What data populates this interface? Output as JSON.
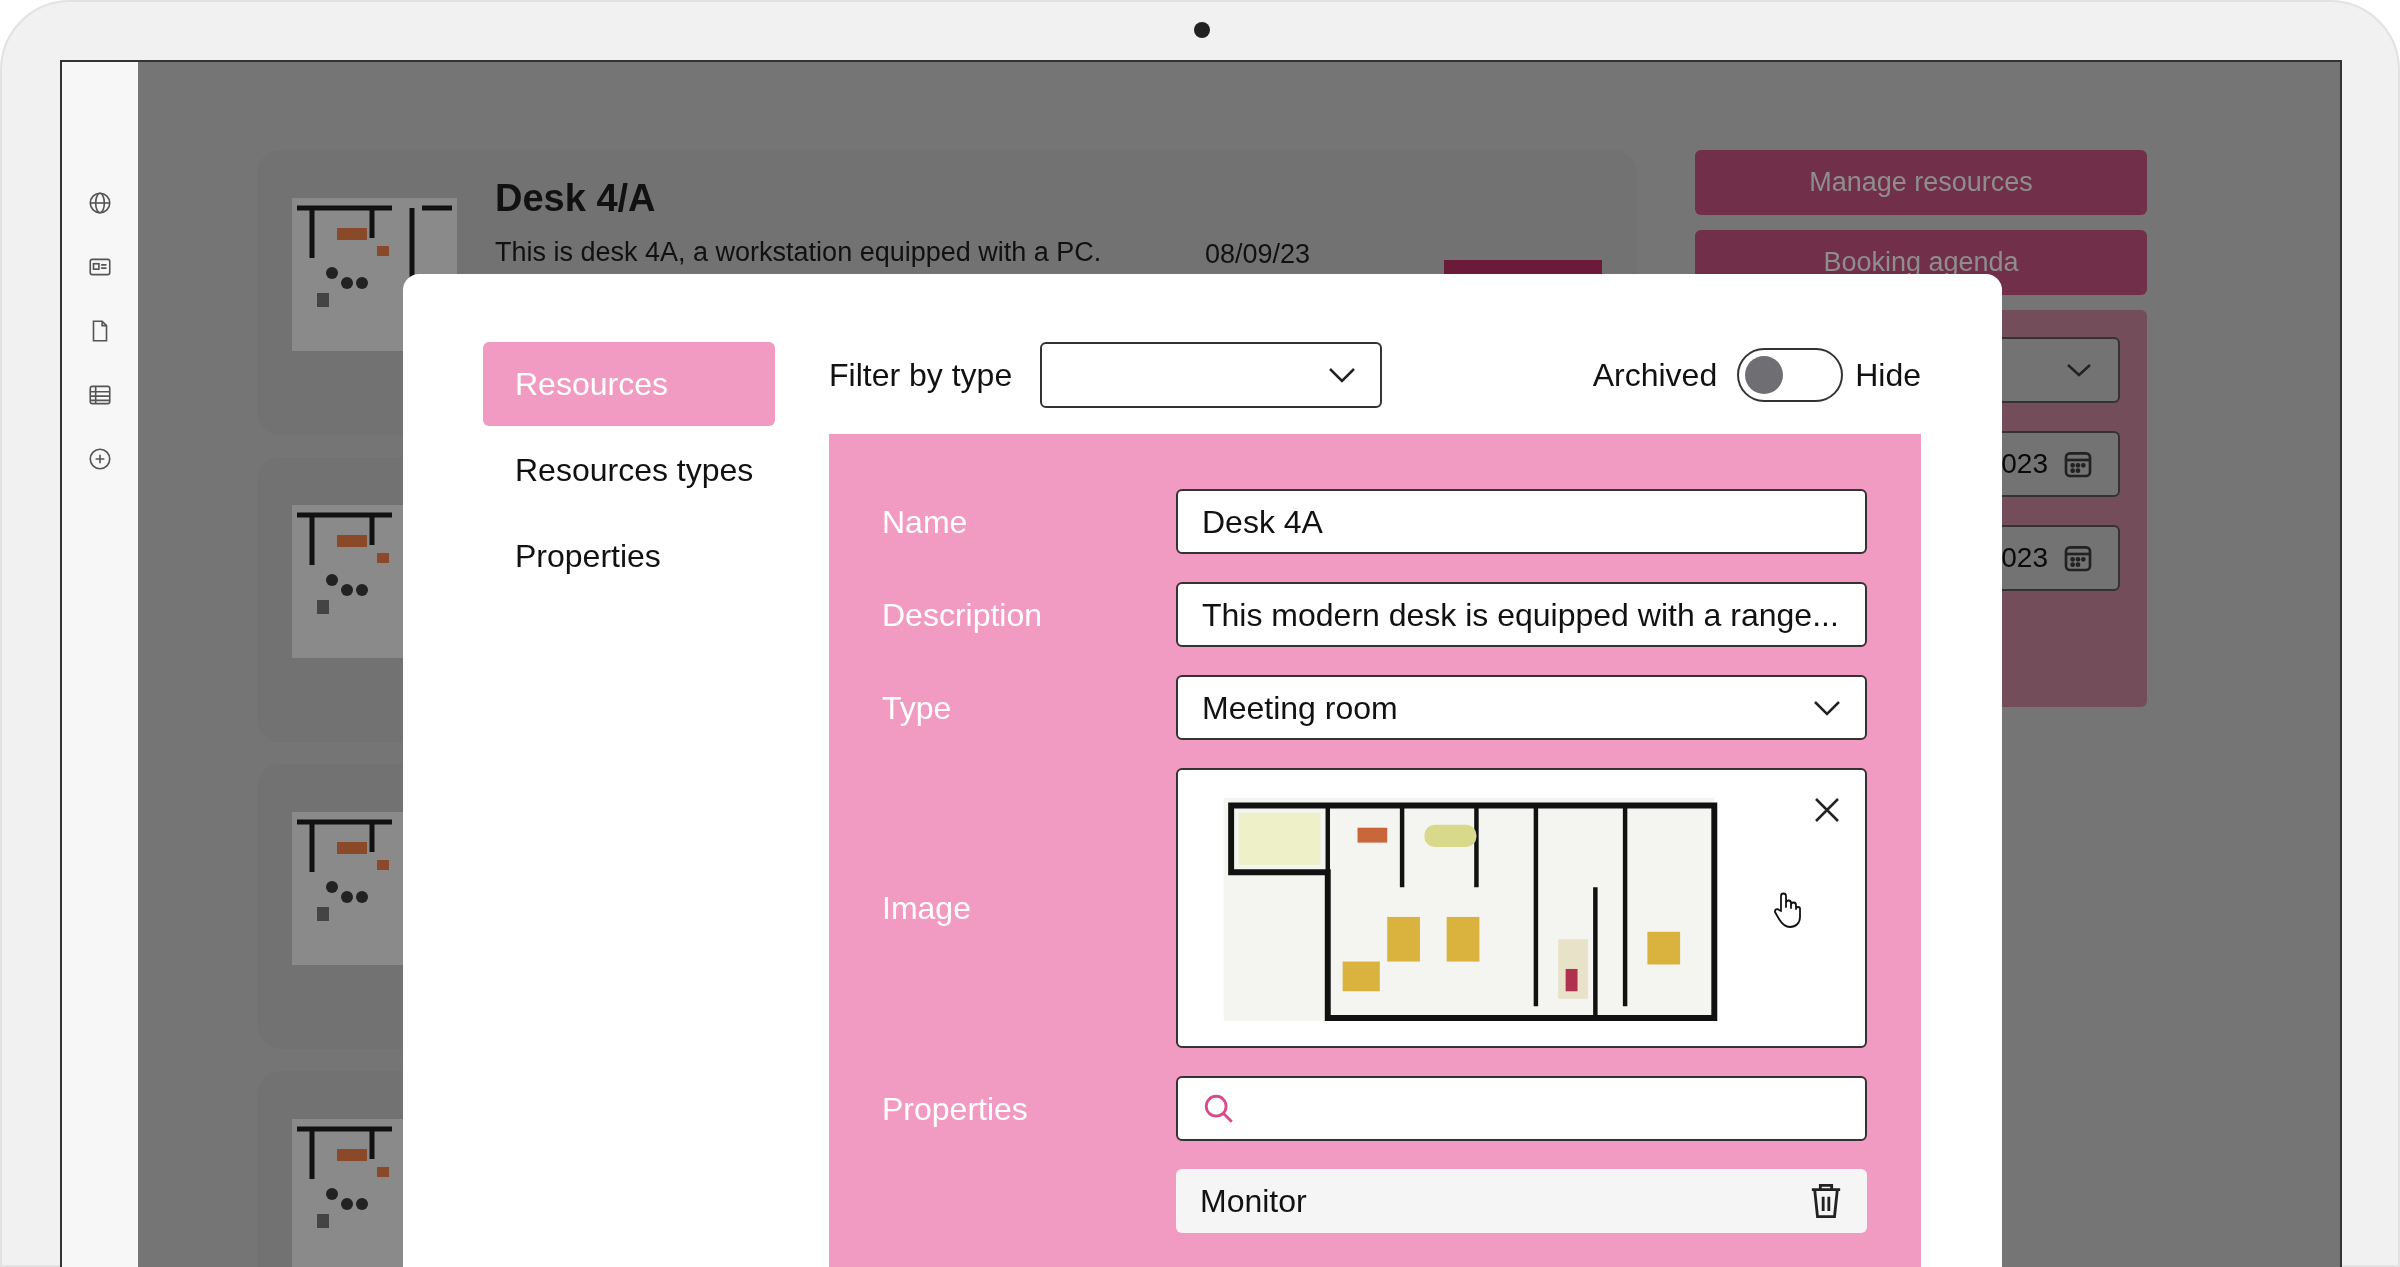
{
  "background": {
    "cards": [
      {
        "kind": "full",
        "title": "Desk 4/A",
        "description": "This is desk 4A, a workstation equipped with a PC.",
        "date": "08/09/23"
      },
      {
        "kind": "thumbnail_only"
      },
      {
        "kind": "thumbnail_only"
      },
      {
        "kind": "thumbnail_only"
      }
    ],
    "buttons": [
      "Manage resources",
      "Booking agenda"
    ],
    "filter_panel": {
      "date_fields": [
        "023",
        "023"
      ]
    }
  },
  "modal": {
    "nav": [
      {
        "label": "Resources",
        "selected": true
      },
      {
        "label": "Resources types",
        "selected": false
      },
      {
        "label": "Properties",
        "selected": false
      }
    ],
    "filter": {
      "label": "Filter by type"
    },
    "archived": {
      "label": "Archived",
      "on": false,
      "state_label": "Hide"
    },
    "form": [
      {
        "kind": "text",
        "label": "Name",
        "value": "Desk 4A"
      },
      {
        "kind": "text",
        "label": "Description",
        "value": "This modern desk is equipped with a range..."
      },
      {
        "kind": "select",
        "label": "Type",
        "value": "Meeting room"
      },
      {
        "kind": "image",
        "label": "Image"
      },
      {
        "kind": "search",
        "label": "Properties"
      },
      {
        "kind": "chip",
        "value": "Monitor"
      }
    ]
  }
}
